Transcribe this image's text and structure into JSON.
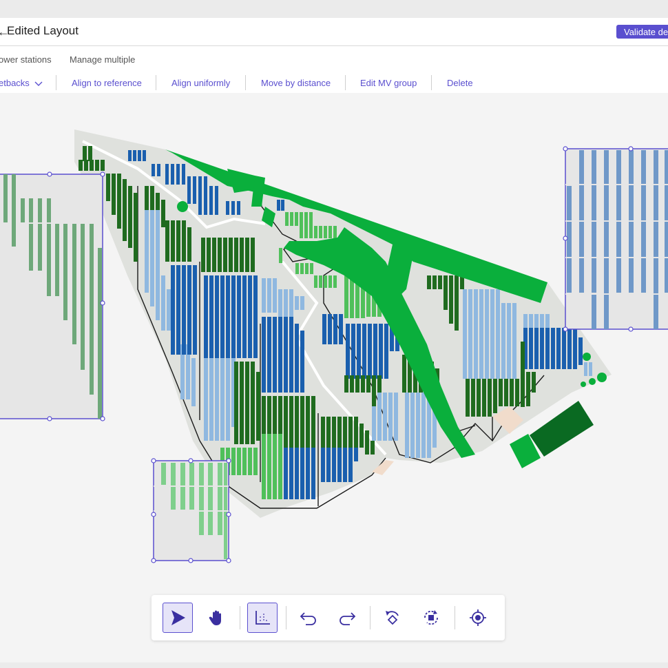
{
  "header": {
    "title": "Edited Layout",
    "back_icon": "arrow-left-icon",
    "validate_label": "Validate de"
  },
  "tabs": [
    {
      "label": "ower stations"
    },
    {
      "label": "Manage multiple"
    }
  ],
  "actions": {
    "setbacks_label": "etbacks",
    "align_reference_label": "Align to reference",
    "align_uniformly_label": "Align uniformly",
    "move_distance_label": "Move by distance",
    "edit_mv_label": "Edit MV group",
    "delete_label": "Delete"
  },
  "toolbar": {
    "tools": [
      "select-tool-icon",
      "pan-hand-icon",
      "snap-grid-icon",
      "undo-icon",
      "redo-icon",
      "rotate-icon",
      "rotate-group-icon",
      "center-target-icon"
    ]
  },
  "colors": {
    "accent": "#5a4fcf",
    "dark_green": "#1f6b1f",
    "bright_green": "#0aaf3c",
    "light_green": "#4fc05a",
    "blue": "#1a5fae",
    "light_blue": "#8fb8e0",
    "pale_green": "#6ea87a",
    "steel_blue": "#6f98c8"
  }
}
